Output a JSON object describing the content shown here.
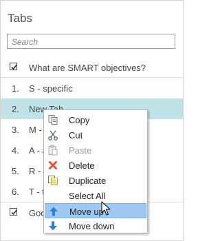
{
  "panel": {
    "title": "Tabs",
    "search": {
      "placeholder": "Search"
    }
  },
  "heading_item": {
    "label": "What are SMART objectives?",
    "checked": true
  },
  "tabs": [
    {
      "num": "1.",
      "label": "S - specific"
    },
    {
      "num": "2.",
      "label": "New Tab",
      "selected": true
    },
    {
      "num": "3.",
      "label": "M - "
    },
    {
      "num": "4.",
      "label": "A - a"
    },
    {
      "num": "5.",
      "label": "R - r"
    },
    {
      "num": "6.",
      "label": "T - t"
    }
  ],
  "footer_item": {
    "label": "Goo",
    "checked": true
  },
  "context_menu": {
    "items": [
      {
        "label": "Copy",
        "icon": "copy-icon",
        "enabled": true
      },
      {
        "label": "Cut",
        "icon": "scissors-icon",
        "enabled": true
      },
      {
        "label": "Paste",
        "icon": "paste-icon",
        "enabled": false
      },
      {
        "label": "Delete",
        "icon": "delete-x-icon",
        "enabled": true
      },
      {
        "label": "Duplicate",
        "icon": "duplicate-icon",
        "enabled": true
      },
      {
        "label": "Select All",
        "icon": "",
        "enabled": true
      },
      {
        "label": "Move up",
        "icon": "arrow-up-icon",
        "enabled": true,
        "hovered": true
      },
      {
        "label": "Move down",
        "icon": "arrow-down-icon",
        "enabled": true
      }
    ]
  },
  "colors": {
    "selected_row": "#bfe3e6",
    "menu_hover": "#9fc7f3",
    "delete_icon": "#e0533b",
    "arrow_icon": "#2f7fd3"
  }
}
